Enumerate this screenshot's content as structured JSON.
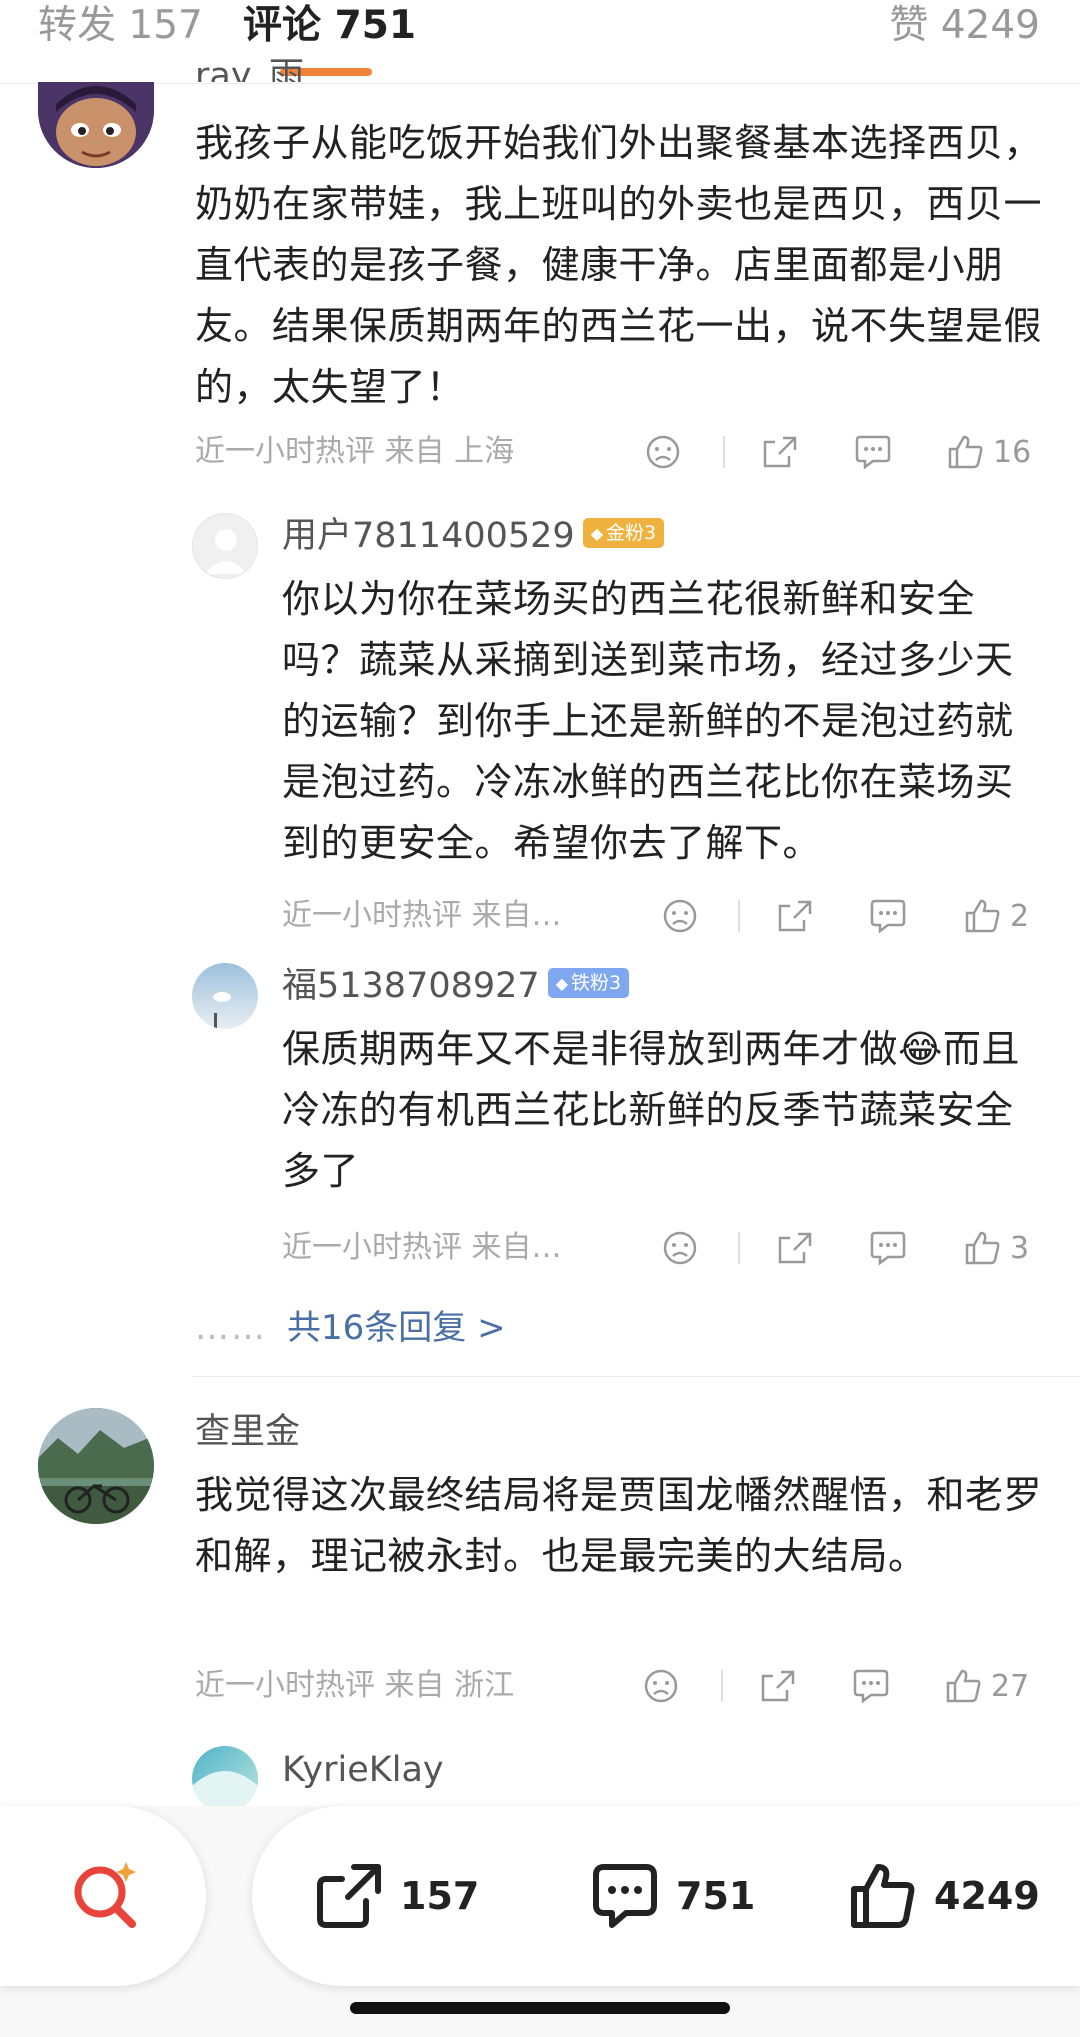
{
  "tabs": {
    "reposts": "转发 157",
    "comments": "评论 751",
    "likes": "赞 4249"
  },
  "comments": [
    {
      "user": "ray_雨",
      "text": "我孩子从能吃饭开始我们外出聚餐基本选择西贝，奶奶在家带娃，我上班叫的外卖也是西贝，西贝一直代表的是孩子餐，健康干净。店里面都是小朋友。结果保质期两年的西兰花一出，说不失望是假的，太失望了！",
      "meta": "近一小时热评 来自 上海",
      "likes": "16",
      "replies": [
        {
          "user": "用户7811400529",
          "badge": "金粉3",
          "text": "你以为你在菜场买的西兰花很新鲜和安全吗？蔬菜从采摘到送到菜市场，经过多少天的运输？到你手上还是新鲜的不是泡过药就是泡过药。冷冻冰鲜的西兰花比你在菜场买到的更安全。希望你去了解下。",
          "meta": "近一小时热评 来自…",
          "likes": "2"
        },
        {
          "user": "福5138708927",
          "badge": "铁粉3",
          "text_line1": "保质期两年又不是非得放到两年才做",
          "emoji": "😂",
          "text_rest": "而且冷冻的有机西兰花比新鲜的反季节蔬菜安全多了",
          "meta": "近一小时热评 来自…",
          "likes": "3"
        }
      ],
      "more_replies": "共16条回复 >",
      "more_dots": "……"
    },
    {
      "user": "查里金",
      "text": "我觉得这次最终结局将是贾国龙幡然醒悟，和老罗和解，理记被永封。也是最完美的大结局。",
      "meta": "近一小时热评 来自 浙江",
      "likes": "27",
      "replies": [
        {
          "user": "KyrieKlay"
        }
      ]
    }
  ],
  "bottom_bar": {
    "reposts": "157",
    "comments": "751",
    "likes": "4249"
  },
  "icons": [
    "dislike-icon",
    "share-icon",
    "comment-icon",
    "like-icon",
    "search-spark-icon"
  ],
  "colors": {
    "accent": "#f0823a",
    "link": "#4a6fa5",
    "badge_gold": "#f0b23e",
    "badge_iron": "#7ea7ef",
    "search_red": "#e8443a"
  }
}
